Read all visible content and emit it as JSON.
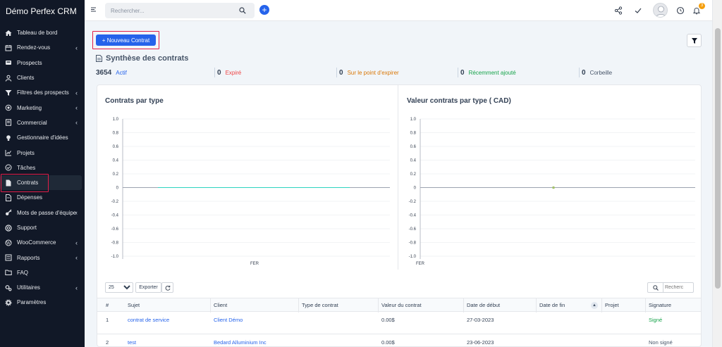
{
  "app": {
    "brand": "Démo Perfex CRM"
  },
  "sidebar": {
    "items": [
      {
        "label": "Tableau de bord",
        "icon": "home-icon",
        "chevron": false
      },
      {
        "label": "Rendez-vous",
        "icon": "calendar-icon",
        "chevron": true
      },
      {
        "label": "Prospects",
        "icon": "tty-icon",
        "chevron": false
      },
      {
        "label": "Clients",
        "icon": "user-icon",
        "chevron": false
      },
      {
        "label": "Filtres des prospects",
        "icon": "filter-icon",
        "chevron": true
      },
      {
        "label": "Marketing",
        "icon": "bullhorn-icon",
        "chevron": true
      },
      {
        "label": "Commercial",
        "icon": "balance-icon",
        "chevron": true
      },
      {
        "label": "Gestionnaire d'idées",
        "icon": "lightbulb-icon",
        "chevron": false
      },
      {
        "label": "Projets",
        "icon": "chart-icon",
        "chevron": false
      },
      {
        "label": "Tâches",
        "icon": "check-circle-icon",
        "chevron": false
      },
      {
        "label": "Contrats",
        "icon": "file-icon",
        "chevron": false,
        "active": true
      },
      {
        "label": "Dépenses",
        "icon": "receipt-icon",
        "chevron": false
      },
      {
        "label": "Mots de passe d'équipe",
        "icon": "key-icon",
        "chevron": true
      },
      {
        "label": "Support",
        "icon": "lifebuoy-icon",
        "chevron": false
      },
      {
        "label": "WooCommerce",
        "icon": "wordpress-icon",
        "chevron": true
      },
      {
        "label": "Rapports",
        "icon": "list-icon",
        "chevron": true
      },
      {
        "label": "FAQ",
        "icon": "folder-icon",
        "chevron": false
      },
      {
        "label": "Utilitaires",
        "icon": "cogs-icon",
        "chevron": true
      },
      {
        "label": "Paramètres",
        "icon": "gear-icon",
        "chevron": false
      }
    ]
  },
  "topbar": {
    "search_placeholder": "Rechercher...",
    "notification_count": "3"
  },
  "main": {
    "new_contract_label": "Nouveau Contrat",
    "summary_title": "Synthèse des contrats",
    "stats": [
      {
        "count": "3654",
        "label": "Actif",
        "color": "#2563eb"
      },
      {
        "count": "0",
        "label": "Expiré",
        "color": "#ef4444"
      },
      {
        "count": "0",
        "label": "Sur le point d'expirer",
        "color": "#d97706"
      },
      {
        "count": "0",
        "label": "Récemment ajouté",
        "color": "#16a34a"
      },
      {
        "count": "0",
        "label": "Corbeille",
        "color": "#475569"
      }
    ]
  },
  "chart_data": [
    {
      "type": "line",
      "title": "Contrats par type",
      "categories": [
        "FER"
      ],
      "series": [
        {
          "values": [
            0
          ],
          "color": "#2dd4bf"
        }
      ],
      "ylim": [
        -1.0,
        1.0
      ],
      "yticks": [
        "1.0",
        "0.8",
        "0.6",
        "0.4",
        "0.2",
        "0",
        "-0.2",
        "-0.4",
        "-0.6",
        "-0.8",
        "-1.0"
      ],
      "grid": true
    },
    {
      "type": "line",
      "title": "Valeur contrats par type ( CAD)",
      "categories": [
        "FER"
      ],
      "series": [
        {
          "values": [
            0
          ],
          "color": "#a3c26b"
        }
      ],
      "ylim": [
        -1.0,
        1.0
      ],
      "yticks": [
        "1.0",
        "0.8",
        "0.6",
        "0.4",
        "0.2",
        "0",
        "-0.2",
        "-0.4",
        "-0.6",
        "-0.8",
        "-1.0"
      ],
      "grid": true
    }
  ],
  "table": {
    "page_size": "25",
    "export_label": "Exporter",
    "search_placeholder": "Recherc",
    "columns": [
      "#",
      "Sujet",
      "Client",
      "Type de contrat",
      "Valeur du contrat",
      "Date de début",
      "Date de fin",
      "Projet",
      "Signature"
    ],
    "rows": [
      {
        "id": "1",
        "subject": "contrat de service",
        "client": "Client Démo",
        "type": "",
        "value": "0.00$",
        "start": "27-03-2023",
        "end": "",
        "project": "",
        "signature": "Signé",
        "signed": true
      },
      {
        "id": "2",
        "subject": "test",
        "client": "Bedard Alluminium Inc",
        "type": "",
        "value": "0.00$",
        "start": "23-06-2023",
        "end": "",
        "project": "",
        "signature": "Non signé",
        "signed": false
      }
    ]
  }
}
